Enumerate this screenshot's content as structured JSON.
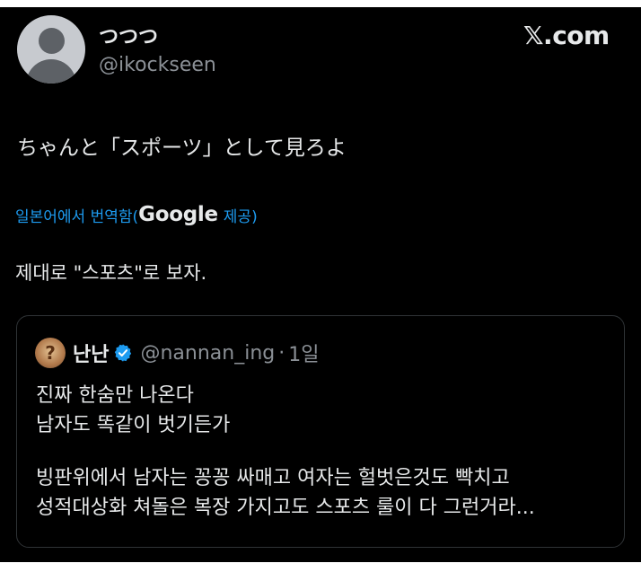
{
  "tweet": {
    "author_name": "つつつ",
    "author_handle": "@ikockseen",
    "brand": "𝕏.com",
    "text": "ちゃんと「スポーツ」として見ろよ"
  },
  "translation": {
    "link_prefix": "일본어에서 번역함(",
    "provider": "Google",
    "link_suffix": "제공)",
    "text": "제대로 \"스포츠\"로 보자."
  },
  "quoted_tweet": {
    "author_name": "난난",
    "author_handle": "@nannan_ing",
    "separator": "·",
    "time": "1일",
    "paragraph_1": [
      "진짜 한숨만 나온다",
      "남자도 똑같이 벗기든가"
    ],
    "paragraph_2": [
      "빙판위에서 남자는 꽁꽁 싸매고 여자는 헐벗은것도 빡치고",
      "성적대상화 쳐돌은 복장 가지고도 스포츠 룰이 다 그런거라..."
    ]
  },
  "colors": {
    "background": "#000000",
    "text": "#e7e9ea",
    "secondary": "#8b9096",
    "link": "#1d9bf0",
    "border": "#2f3336"
  },
  "icons": [
    "default-avatar-icon",
    "verified-badge-icon"
  ]
}
